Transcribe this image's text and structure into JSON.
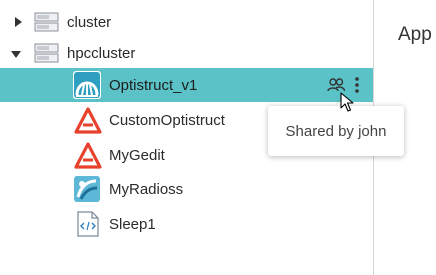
{
  "tree": {
    "clusters": [
      {
        "label": "cluster",
        "expanded": false
      },
      {
        "label": "hpccluster",
        "expanded": true
      }
    ],
    "apps": [
      {
        "label": "Optistruct_v1",
        "icon": "optistruct-logo",
        "selected": true,
        "shared": true
      },
      {
        "label": "CustomOptistruct",
        "icon": "altair-logo"
      },
      {
        "label": "MyGedit",
        "icon": "altair-logo"
      },
      {
        "label": "MyRadioss",
        "icon": "radioss-logo"
      },
      {
        "label": "Sleep1",
        "icon": "code-file-icon"
      }
    ]
  },
  "tooltip": {
    "text": "Shared by john"
  },
  "main": {
    "title": "App"
  },
  "colors": {
    "selected_row": "#5bc3c7",
    "altair_red": "#e8412c",
    "teal_icon": "#2f9fc1"
  }
}
